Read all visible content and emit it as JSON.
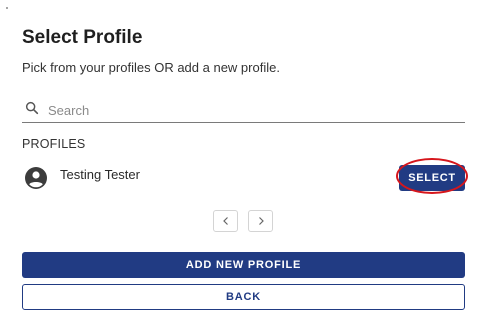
{
  "dialog": {
    "title": "Select Profile",
    "subtitle": "Pick from your profiles OR add a new profile."
  },
  "search": {
    "placeholder": "Search",
    "value": "",
    "icon": "search-icon"
  },
  "profiles": {
    "section_label": "PROFILES",
    "items": [
      {
        "name": "Testing Tester",
        "avatar_icon": "account-circle-icon",
        "select_label": "SELECT"
      }
    ]
  },
  "pagination": {
    "prev_icon": "chevron-left-icon",
    "next_icon": "chevron-right-icon"
  },
  "actions": {
    "add_label": "ADD NEW PROFILE",
    "back_label": "BACK"
  },
  "colors": {
    "primary": "#213b83",
    "highlight": "#d6161c"
  }
}
